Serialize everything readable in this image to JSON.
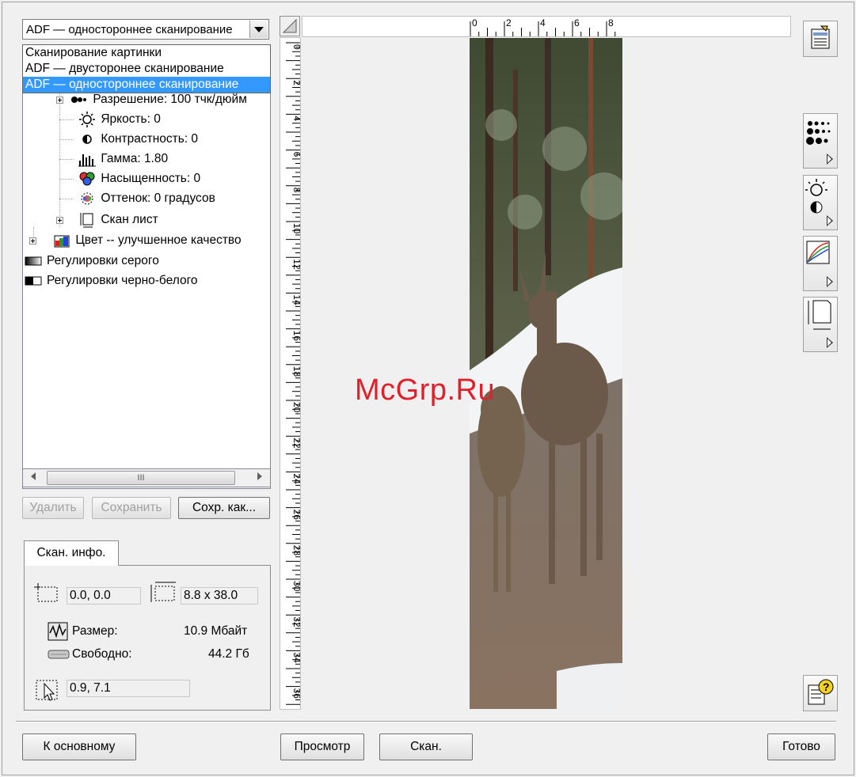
{
  "profile_combo": {
    "value": "ADF — одностороннее сканирование"
  },
  "profile_dropdown": {
    "options": [
      "Сканирование картинки",
      "ADF — двусторонее сканирование",
      "ADF — одностороннее сканирование"
    ],
    "selected_index": 2
  },
  "tree": {
    "items": [
      {
        "label": "Разрешение: 100 тчк/дюйм"
      },
      {
        "label": "Яркость: 0"
      },
      {
        "label": "Контрастность: 0"
      },
      {
        "label": "Гамма: 1.80"
      },
      {
        "label": "Насыщенность: 0"
      },
      {
        "label": "Оттенок: 0 градусов"
      },
      {
        "label": "Скан лист"
      },
      {
        "label": "Цвет -- улучшенное качество"
      },
      {
        "label": "Регулировки серого"
      },
      {
        "label": "Регулировки черно-белого"
      }
    ]
  },
  "scrollbar": {
    "thumb_glyph": "III"
  },
  "profile_buttons": {
    "delete": "Удалить",
    "save": "Сохранить",
    "save_as": "Сохр. как..."
  },
  "scan_info": {
    "tab_label": "Скан. инфо.",
    "origin": "0.0, 0.0",
    "dimensions": "8.8 x 38.0",
    "size_label": "Размер:",
    "size_value": "10.9 Мбайт",
    "free_label": "Свободно:",
    "free_value": "44.2 Гб",
    "cursor": "0.9, 7.1"
  },
  "rulers": {
    "horizontal_labels": [
      "0",
      "2",
      "4",
      "6",
      "8"
    ],
    "vertical_labels": [
      "0",
      "2",
      "4",
      "6",
      "8",
      "10",
      "12",
      "14",
      "16",
      "18",
      "20",
      "22",
      "24",
      "26",
      "28",
      "30",
      "32",
      "34",
      "36"
    ]
  },
  "watermark": "McGrp.Ru",
  "bottom_buttons": {
    "main": "К основному",
    "preview": "Просмотр",
    "scan": "Скан.",
    "done": "Готово"
  },
  "colors": {
    "selection": "#3399ff",
    "watermark": "#e0202a"
  }
}
